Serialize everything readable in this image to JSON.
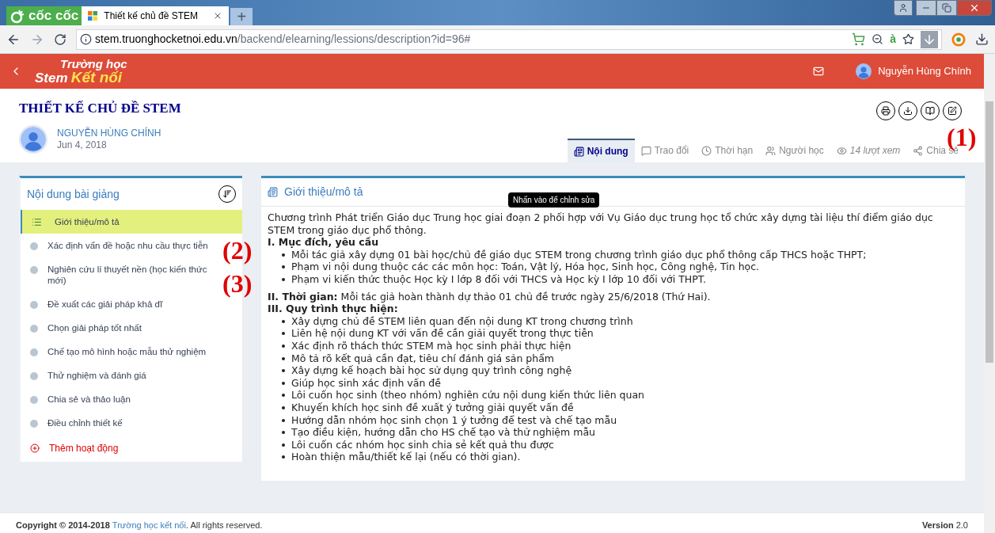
{
  "browser": {
    "brand": "cốc cốc",
    "tab_title": "Thiết kế chủ đề STEM",
    "new_tab": "+",
    "url_host": "stem.truonghocketnoi.edu.vn",
    "url_path": "/backend/elearning/lessions/description?id=96#",
    "translate_glyph": "à"
  },
  "header": {
    "logo_top": "Trường học",
    "logo_stem": "Stem",
    "logo_bottom": "Kết nối",
    "user_name": "Nguyễn Hùng Chính"
  },
  "lesson": {
    "title": "THIẾT KẾ CHỦ ĐỀ STEM",
    "author": "NGUYỄN HÙNG CHÍNH",
    "date": "Jun 4, 2018"
  },
  "tabs": [
    {
      "label": "Nội dung",
      "selected": true,
      "kind": "content"
    },
    {
      "label": "Trao đổi",
      "selected": false,
      "kind": "chat"
    },
    {
      "label": "Thời hạn",
      "selected": false,
      "kind": "clock"
    },
    {
      "label": "Người học",
      "selected": false,
      "kind": "users"
    },
    {
      "label": "14 lượt xem",
      "selected": false,
      "kind": "views"
    },
    {
      "label": "Chia sẻ",
      "selected": false,
      "kind": "share"
    }
  ],
  "sidebar": {
    "title": "Nội dung bài giảng",
    "items": [
      {
        "label": "Giới thiệu/mô tả",
        "selected": true
      },
      {
        "label": "Xác định vấn đề hoặc nhu cầu thực tiễn",
        "selected": false
      },
      {
        "label": "Nghiên cứu lí thuyết nền (học kiến thức mới)",
        "selected": false
      },
      {
        "label": "Đề xuất các giải pháp khả dĩ",
        "selected": false
      },
      {
        "label": "Chọn giải pháp tốt nhất",
        "selected": false
      },
      {
        "label": "Chế tạo mô hình hoặc mẫu thử nghiệm",
        "selected": false
      },
      {
        "label": "Thử nghiệm và đánh giá",
        "selected": false
      },
      {
        "label": "Chia sẻ và thảo luận",
        "selected": false
      },
      {
        "label": "Điều chỉnh thiết kế",
        "selected": false
      }
    ],
    "add_label": "Thêm hoạt động"
  },
  "content": {
    "title": "Giới thiệu/mô tả",
    "tooltip": "Nhấn vào để chỉnh sửa",
    "blocks": [
      {
        "kind": "paragraph",
        "text": "Chương trình Phát triển Giáo dục Trung học giai đoạn 2 phối hợp với Vụ Giáo dục trung học tổ chức xây dựng tài liệu thí điểm giáo dục STEM trong giáo dục phổ thông."
      },
      {
        "kind": "heading",
        "text": "I. Mục đích, yêu cầu"
      },
      {
        "kind": "bullets",
        "items": [
          "Mỗi tác giả xây dựng 01 bài học/chủ đề giáo dục STEM trong chương trình giáo dục phổ thông cấp THCS hoặc THPT;",
          "Phạm vi nội dung thuộc các các môn học: Toán, Vật lý, Hóa học, Sinh học, Công nghệ, Tin học.",
          "Phạm vi kiến thức thuộc Học kỳ I lớp 8 đối với THCS và Học kỳ I lớp 10 đối với THPT."
        ]
      },
      {
        "kind": "paragraph",
        "text": "**II. Thời gian:** Mỗi tác giả hoàn thành dự thảo 01 chủ đề trước ngày 25/6/2018 (Thứ Hai)."
      },
      {
        "kind": "heading",
        "text": "III. Quy trình thực hiện:"
      },
      {
        "kind": "bullets",
        "items": [
          "Xây dựng chủ đề STEM liên quan đến nội dung KT trong chương trình",
          "Liên hệ nội dung KT với vấn đề cần giải quyết trong thực tiễn",
          "Xác định rõ thách thức STEM mà học sinh phải thực hiện",
          "Mô tả rõ kết quả cần đạt, tiêu chí đánh giá sản phẩm",
          "Xây dựng kế hoạch bài học sử dụng quy trình công nghệ",
          "Giúp học sinh xác định vấn đề",
          "Lôi cuốn học sinh (theo nhóm) nghiên cứu nội dung kiến thức liên quan",
          "Khuyến khích học sinh đề xuất ý tưởng giải quyết vấn đề",
          "Hướng dẫn nhóm học sinh chọn 1 ý tưởng để test và chế tạo mẫu",
          "Tạo điều kiện, hướng dẫn cho HS chế tạo và thử nghiệm mẫu",
          "Lôi cuốn các nhóm học sinh chia sẻ kết quả thu được",
          "Hoàn thiện mẫu/thiết kế lại (nếu có thời gian)."
        ]
      }
    ]
  },
  "annotations": [
    "(1)",
    "(2)",
    "(3)"
  ],
  "footer": {
    "copyright": "Copyright © 2014-2018",
    "link": "Trường học kết nối",
    "rights": ". All rights reserved.",
    "version": "**Version** 2.0"
  }
}
